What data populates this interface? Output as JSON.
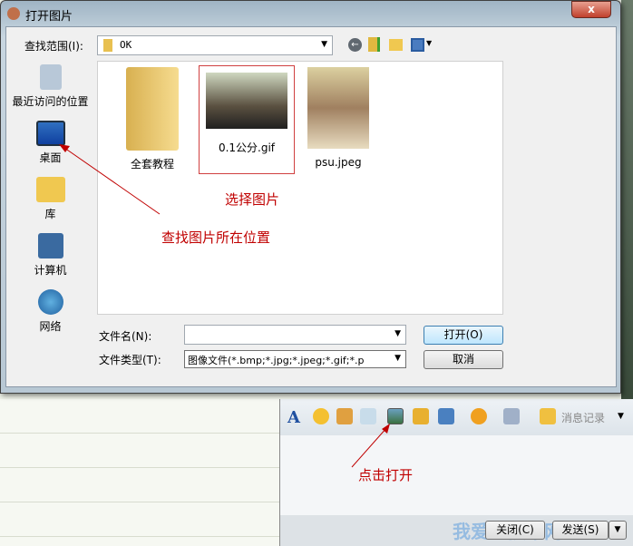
{
  "dialog": {
    "title": "打开图片",
    "close": "x",
    "look_in_label": "查找范围(I):",
    "look_in_value": "OK",
    "places": [
      {
        "label": "最近访问的位置",
        "icon": "recent-places-icon"
      },
      {
        "label": "桌面",
        "icon": "desktop-icon"
      },
      {
        "label": "库",
        "icon": "library-icon"
      },
      {
        "label": "计算机",
        "icon": "computer-icon"
      },
      {
        "label": "网络",
        "icon": "network-icon"
      }
    ],
    "files": [
      {
        "name": "全套教程",
        "icon": "folder-icon"
      },
      {
        "name": "0.1公分.gif",
        "icon": "image-thumbnail"
      },
      {
        "name": "psu.jpeg",
        "icon": "image-thumbnail"
      }
    ],
    "filename_label": "文件名(N):",
    "filename_value": "",
    "filetype_label": "文件类型(T):",
    "filetype_value": "图像文件(*.bmp;*.jpg;*.jpeg;*.gif;*.p",
    "open_button": "打开(O)",
    "cancel_button": "取消"
  },
  "annotations": {
    "select_image": "选择图片",
    "find_location": "查找图片所在位置",
    "click_open": "点击打开"
  },
  "chat": {
    "history": "消息记录",
    "close_button": "关闭(C)",
    "send_button": "发送(S)"
  },
  "watermark": "我爱IT技术网",
  "colors": {
    "annotation": "#c00000"
  }
}
